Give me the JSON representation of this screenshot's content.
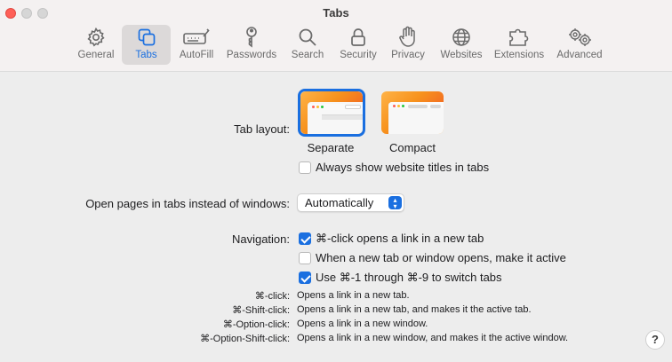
{
  "window": {
    "title": "Tabs"
  },
  "toolbar": {
    "tabs": [
      {
        "label": "General",
        "icon": "gear-icon"
      },
      {
        "label": "Tabs",
        "icon": "tabs-icon",
        "active": true
      },
      {
        "label": "AutoFill",
        "icon": "autofill-icon"
      },
      {
        "label": "Passwords",
        "icon": "key-icon"
      },
      {
        "label": "Search",
        "icon": "search-icon"
      },
      {
        "label": "Security",
        "icon": "lock-icon"
      },
      {
        "label": "Privacy",
        "icon": "hand-icon"
      },
      {
        "label": "Websites",
        "icon": "globe-icon"
      },
      {
        "label": "Extensions",
        "icon": "puzzle-icon"
      },
      {
        "label": "Advanced",
        "icon": "gears-icon"
      }
    ]
  },
  "tab_layout": {
    "label": "Tab layout:",
    "options": [
      {
        "label": "Separate",
        "selected": true
      },
      {
        "label": "Compact",
        "selected": false
      }
    ],
    "always_show_titles": {
      "label": "Always show website titles in tabs",
      "checked": false
    }
  },
  "open_pages": {
    "label": "Open pages in tabs instead of windows:",
    "value": "Automatically"
  },
  "navigation": {
    "label": "Navigation:",
    "options": [
      {
        "label": "⌘-click opens a link in a new tab",
        "checked": true
      },
      {
        "label": "When a new tab or window opens, make it active",
        "checked": false
      },
      {
        "label": "Use ⌘-1 through ⌘-9 to switch tabs",
        "checked": true
      }
    ]
  },
  "shortcuts": [
    {
      "key": "⌘-click:",
      "desc": "Opens a link in a new tab."
    },
    {
      "key": "⌘-Shift-click:",
      "desc": "Opens a link in a new tab, and makes it the active tab."
    },
    {
      "key": "⌘-Option-click:",
      "desc": "Opens a link in a new window."
    },
    {
      "key": "⌘-Option-Shift-click:",
      "desc": "Opens a link in a new window, and makes it the active window."
    }
  ],
  "help": {
    "label": "?"
  },
  "colors": {
    "accent": "#1a6fe0",
    "close": "#fe5f57"
  }
}
